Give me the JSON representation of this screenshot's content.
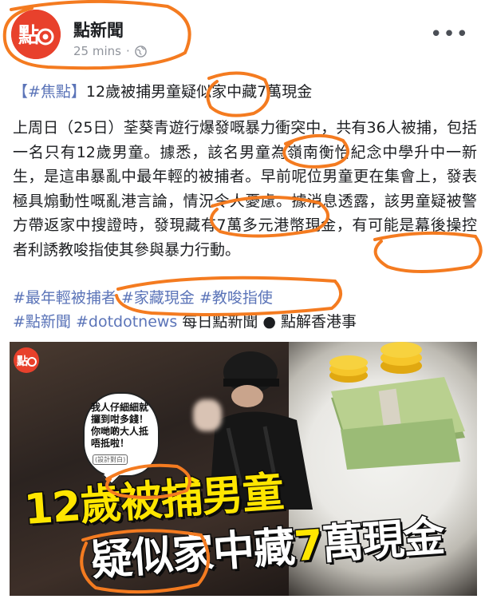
{
  "page": {
    "name": "點新聞",
    "time": "25 mins",
    "separator": "·"
  },
  "post": {
    "title_tag": "【#焦點】",
    "title_text": "12歲被捕男童疑似家中藏7萬現金",
    "body": "上周日（25日）荃葵青遊行爆發嘅暴力衝突中，共有36人被捕，包括一名只有12歲男童。據悉，該名男童為嶺南衡怡紀念中學升中一新生，是這串暴亂中最年輕的被捕者。早前呢位男童更在集會上，發表極具煽動性嘅亂港言論，情況令人憂慮。據消息透露，該男童疑被警方帶返家中搜證時，發現藏有7萬多元港幣現金，有可能是幕後操控者利誘教唆指使其參與暴力行動。",
    "hashtags": [
      "#最年輕被捕者",
      "#家藏現金",
      "#教唆指使"
    ],
    "hashtag_line2": [
      "#點新聞",
      "#dotdotnews"
    ],
    "trailer": " 每日點新聞 ● 點解香港事"
  },
  "thumbnail": {
    "bubble_text": "我人仔細細就攞到咁多錢！你哋啲大人抵唔抵啦！",
    "bubble_note": "(設計對白)",
    "headline_line1": "12歲被捕男童",
    "headline_line2_white": "疑似家中藏",
    "headline_line2_yellow": "7",
    "headline_line2_end": "萬現金"
  },
  "colors": {
    "brand_red": "#e8412c",
    "hashtag_blue": "#5b74b8",
    "annotation_orange": "#f47b20",
    "headline_yellow": "#ffe600"
  },
  "icons": [
    "dotdot-logo",
    "globe-icon",
    "more-options-icon"
  ]
}
